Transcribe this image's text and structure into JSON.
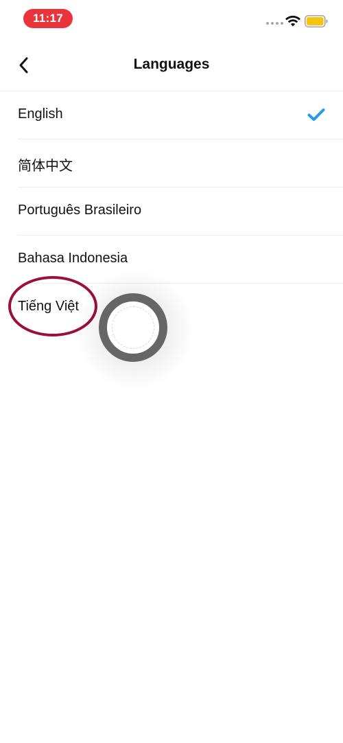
{
  "status_bar": {
    "time": "11:17",
    "time_pill_color": "#e8343a",
    "battery_color": "#f5c40f",
    "icons": [
      "cellular-dots-icon",
      "wifi-icon",
      "battery-icon"
    ]
  },
  "nav": {
    "back_icon": "chevron-left-icon",
    "title": "Languages"
  },
  "languages": {
    "items": [
      {
        "label": "English",
        "selected": true
      },
      {
        "label": "简体中文",
        "selected": false
      },
      {
        "label": "Português Brasileiro",
        "selected": false
      },
      {
        "label": "Bahasa Indonesia",
        "selected": false
      },
      {
        "label": "Tiếng Việt",
        "selected": false
      }
    ],
    "check_icon": "checkmark-icon",
    "check_color": "#1e9bf0"
  },
  "annotation": {
    "ellipse_color": "#9a0f3c",
    "touch_indicator_color": "#666666"
  }
}
